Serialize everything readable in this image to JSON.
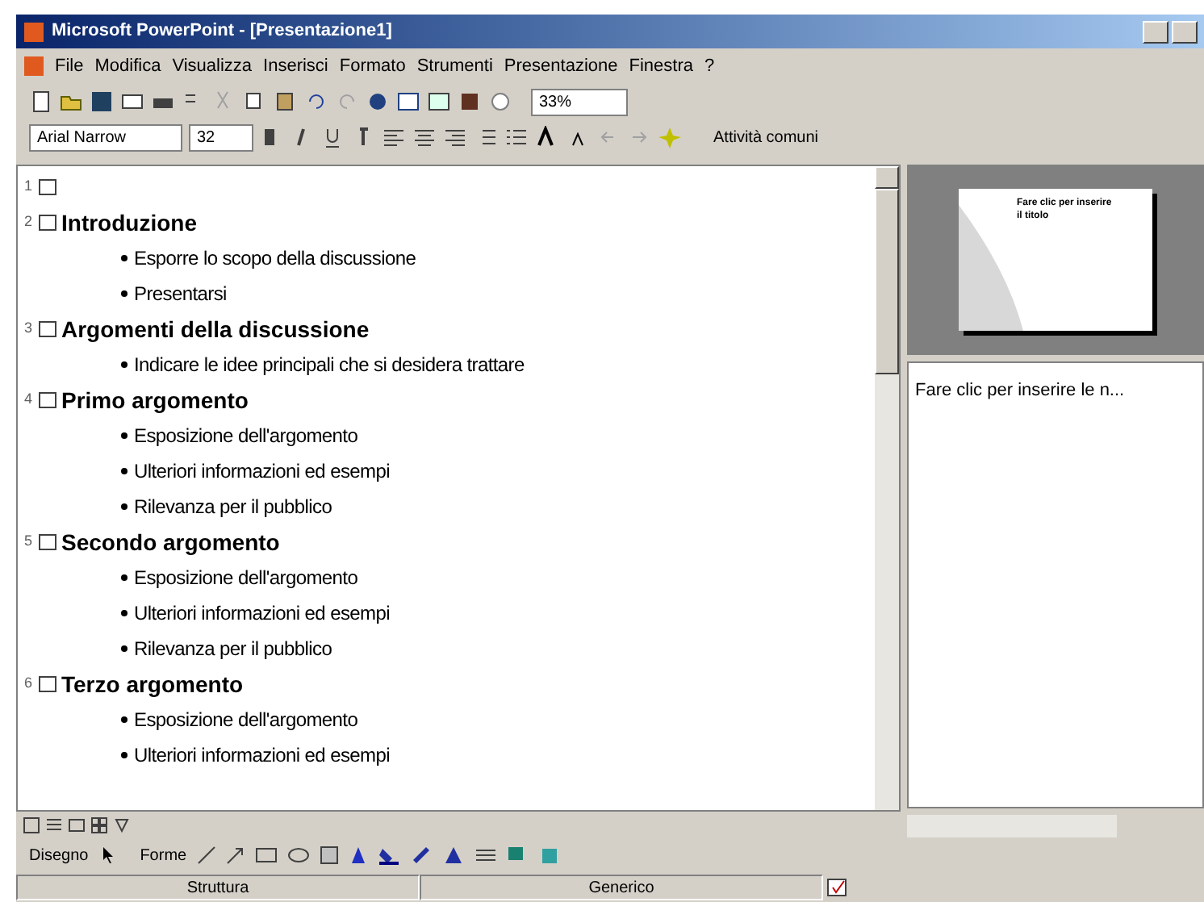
{
  "window": {
    "title": "Microsoft PowerPoint - [Presentazione1]"
  },
  "menu": [
    "File",
    "Modifica",
    "Visualizza",
    "Inserisci",
    "Formato",
    "Strumenti",
    "Presentazione",
    "Finestra",
    "?"
  ],
  "toolbar": {
    "zoom": "33%"
  },
  "format_toolbar": {
    "font": "Arial Narrow",
    "size": "32",
    "tasks": "Attività comuni"
  },
  "outline": [
    {
      "number": "1"
    },
    {
      "number": "2",
      "title": "Introduzione",
      "bullets": [
        "Esporre lo scopo della discussione",
        "Presentarsi"
      ]
    },
    {
      "number": "3",
      "title": "Argomenti della discussione",
      "bullets": [
        "Indicare le idee principali che si desidera trattare"
      ]
    },
    {
      "number": "4",
      "title": "Primo argomento",
      "bullets": [
        "Esposizione dell'argomento",
        "Ulteriori informazioni ed esempi",
        "Rilevanza per il pubblico"
      ]
    },
    {
      "number": "5",
      "title": "Secondo argomento",
      "bullets": [
        "Esposizione dell'argomento",
        "Ulteriori informazioni ed esempi",
        "Rilevanza per il pubblico"
      ]
    },
    {
      "number": "6",
      "title": "Terzo argomento",
      "bullets": [
        "Esposizione dell'argomento",
        "Ulteriori informazioni ed esempi"
      ]
    }
  ],
  "slide_preview": {
    "title": "Fare clic per inserire il titolo"
  },
  "notes": {
    "text": "Fare clic per inserire le n..."
  },
  "drawing_toolbar": {
    "draw": "Disegno",
    "shapes": "Forme"
  },
  "status_bar": [
    "Struttura",
    "Generico"
  ]
}
